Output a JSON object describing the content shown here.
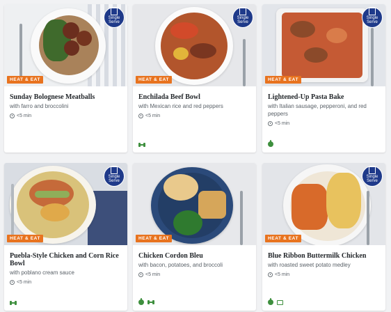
{
  "colors": {
    "tag_bg": "#e8731f",
    "badge_bg": "#1f3a8a",
    "icon_green": "#3e8f3e"
  },
  "cards": [
    {
      "title": "Sunday Bolognese Meatballs",
      "subtitle": "with farro and broccolini",
      "time": "<5 min",
      "tag": "HEAT & EAT",
      "badge": "Single Serve",
      "icons": []
    },
    {
      "title": "Enchilada Beef Bowl",
      "subtitle": "with Mexican rice and red peppers",
      "time": "<5 min",
      "tag": "HEAT & EAT",
      "badge": "Single Serve",
      "icons": [
        "dumbbell-icon"
      ]
    },
    {
      "title": "Lightened-Up Pasta Bake",
      "subtitle": "with Italian sausage, pepperoni, and red peppers",
      "time": "<5 min",
      "tag": "HEAT & EAT",
      "badge": "Single Serve",
      "icons": [
        "apple-icon"
      ]
    },
    {
      "title": "Puebla-Style Chicken and Corn Rice Bowl",
      "subtitle": "with poblano cream sauce",
      "time": "<5 min",
      "tag": "HEAT & EAT",
      "badge": "Single Serve",
      "icons": [
        "dumbbell-icon"
      ]
    },
    {
      "title": "Chicken Cordon Bleu",
      "subtitle": "with bacon, potatoes, and broccoli",
      "time": "<5 min",
      "tag": "HEAT & EAT",
      "badge": "",
      "icons": [
        "apple-icon",
        "dumbbell-icon"
      ]
    },
    {
      "title": "Blue Ribbon Buttermilk Chicken",
      "subtitle": "with roasted sweet potato medley",
      "time": "<5 min",
      "tag": "HEAT & EAT",
      "badge": "Single Serve",
      "icons": [
        "apple-icon",
        "pan-icon"
      ]
    }
  ]
}
